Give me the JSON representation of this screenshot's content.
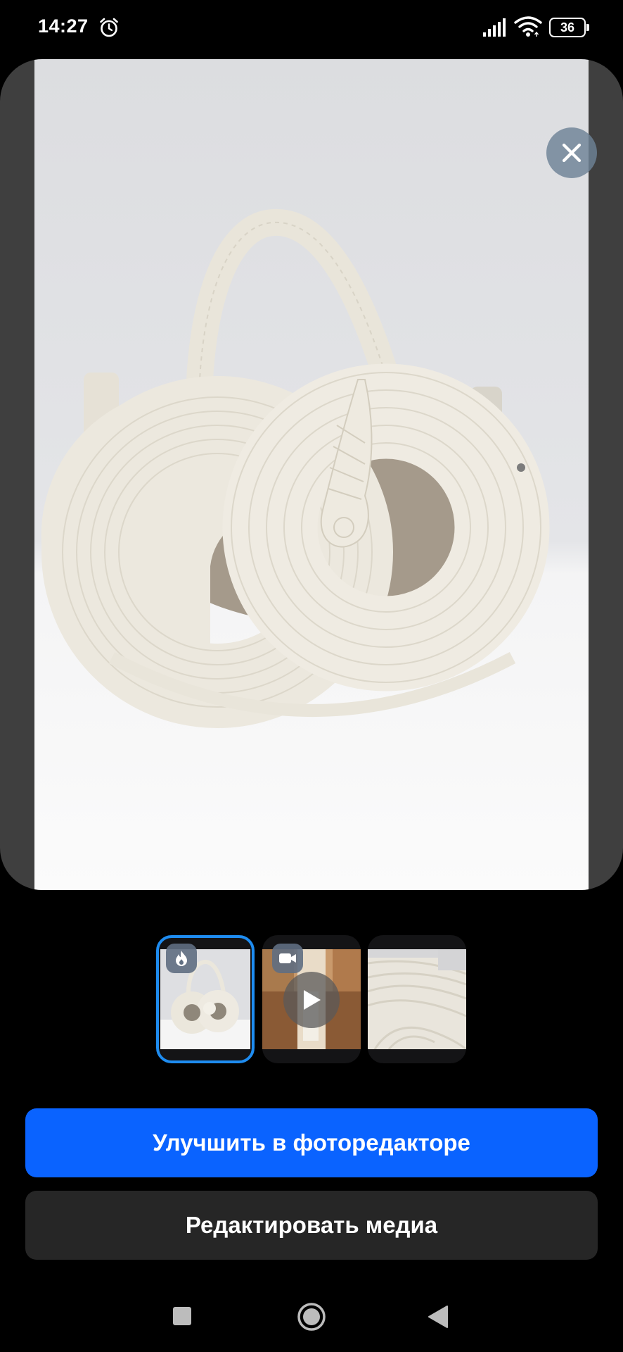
{
  "status_bar": {
    "time": "14:27",
    "battery_level": "36",
    "icons": [
      "alarm-icon",
      "signal-icon",
      "wifi-icon",
      "battery-icon"
    ]
  },
  "viewer": {
    "close_icon": "close-icon",
    "photo": "white coiled rope handbag with knotted leaf charm on light grey backdrop"
  },
  "thumbnails": [
    {
      "type": "photo",
      "selected": true,
      "badge_icon": "fire-icon"
    },
    {
      "type": "video",
      "selected": false,
      "badge_icon": "video-camera-icon",
      "overlay_icon": "play-icon"
    },
    {
      "type": "photo",
      "selected": false
    }
  ],
  "actions": {
    "enhance_label": "Улучшить в фоторедакторе",
    "edit_media_label": "Редактировать медиа"
  },
  "nav": {
    "icons": [
      "nav-recent-icon",
      "nav-home-icon",
      "nav-back-icon"
    ]
  },
  "colors": {
    "accent": "#0a63ff",
    "selected_border": "#1e8cf0",
    "secondary_button": "#262626",
    "background": "#000000"
  }
}
